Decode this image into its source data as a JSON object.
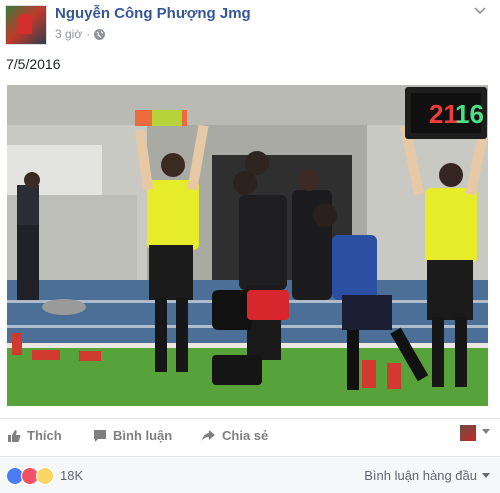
{
  "post": {
    "author": "Nguyễn Công Phượng Jmg",
    "time": "3 giờ",
    "separator": "·",
    "text": "7/5/2016"
  },
  "photo": {
    "board_left": "21",
    "board_right": "16"
  },
  "actions": {
    "like": "Thích",
    "comment": "Bình luận",
    "share": "Chia sẻ"
  },
  "stats": {
    "reaction_count": "18K",
    "sort_label": "Bình luận hàng đầu"
  },
  "icons": {
    "menu": "chevron-down-icon",
    "privacy": "globe-icon",
    "like": "thumbs-up-icon",
    "comment": "comment-icon",
    "share": "share-arrow-icon"
  },
  "colors": {
    "author_link": "#365899",
    "like_reaction": "#4a7cf6",
    "love_reaction": "#f25268",
    "wow_reaction": "#fad664"
  }
}
